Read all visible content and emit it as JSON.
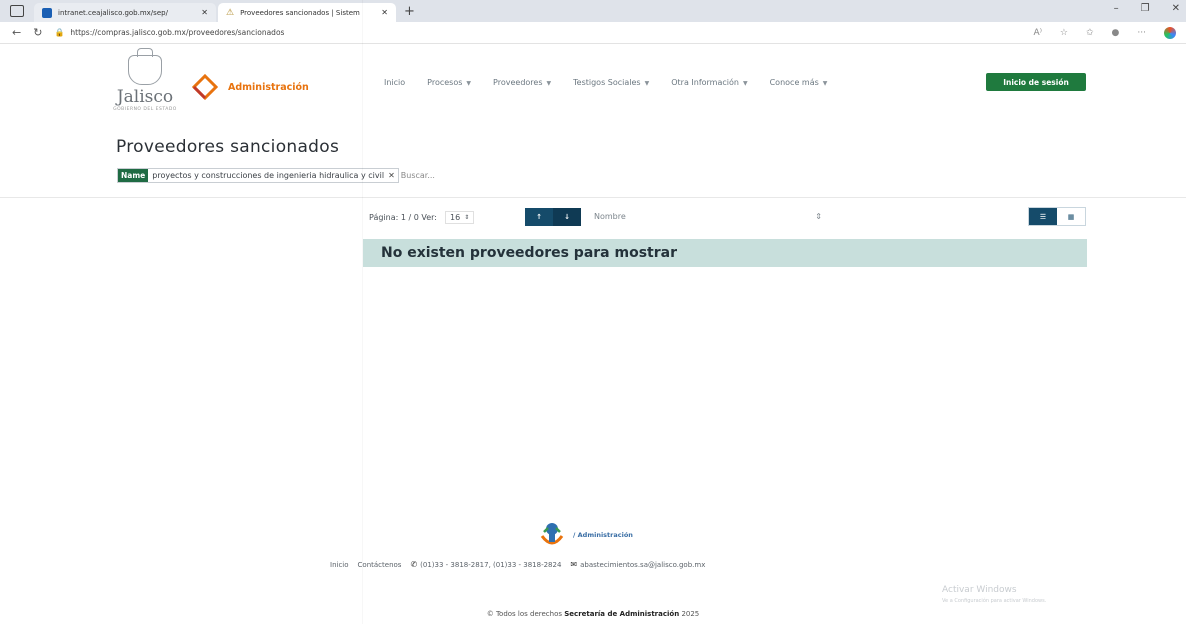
{
  "browser": {
    "tabs": [
      {
        "title": "intranet.ceajalisco.gob.mx/sep/",
        "active": false
      },
      {
        "title": "Proveedores sancionados | Sistem",
        "active": true
      }
    ],
    "url": "https://compras.jalisco.gob.mx/proveedores/sancionados"
  },
  "header": {
    "logo_word": "Jalisco",
    "logo_sub": "GOBIERNO DEL ESTADO",
    "admin_label": "Administración",
    "nav": [
      {
        "label": "Inicio",
        "dropdown": false
      },
      {
        "label": "Procesos",
        "dropdown": true
      },
      {
        "label": "Proveedores",
        "dropdown": true
      },
      {
        "label": "Testigos Sociales",
        "dropdown": true
      },
      {
        "label": "Otra Información",
        "dropdown": true
      },
      {
        "label": "Conoce más",
        "dropdown": true
      }
    ],
    "login_label": "Inicio de sesión"
  },
  "page": {
    "title": "Proveedores sancionados",
    "filter": {
      "key": "Name",
      "value": "proyectos y construcciones de ingenieria hidraulica y civil",
      "search_placeholder": "Buscar..."
    }
  },
  "results": {
    "pager_text": "Página: 1 / 0 Ver:",
    "per_page": "16",
    "sort_asc": "↑",
    "sort_desc": "↓",
    "sort_field": "Nombre",
    "empty_message": "No existen proveedores para mostrar"
  },
  "footer": {
    "admin_label": "/ Administración",
    "links": {
      "inicio": "Inicio",
      "contact": "Contáctenos",
      "phones": "(01)33 - 3818-2817, (01)33 - 3818-2824",
      "email": "abastecimientos.sa@jalisco.gob.mx"
    },
    "copyright_prefix": "© Todos los derechos",
    "copyright_org": "Secretaría de Administración",
    "copyright_year": "2025"
  },
  "watermark": {
    "title": "Activar Windows",
    "subtitle": "Ve a Configuración para activar Windows."
  },
  "colors": {
    "brand_green": "#1f7a3e",
    "admin_orange": "#e8730e",
    "sort_blue": "#154b6a",
    "alert_bg": "#c8dfdc"
  }
}
